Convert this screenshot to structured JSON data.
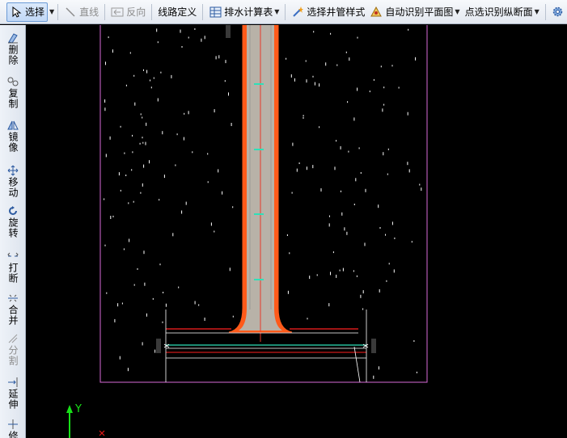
{
  "toolbar": {
    "select_label": "选择",
    "line_label": "直线",
    "reverse_label": "反向",
    "route_define_label": "线路定义",
    "drain_calc_label": "排水计算表",
    "select_well_style_label": "选择井管样式",
    "auto_recognize_label": "自动识别平面图",
    "point_recognize_label": "点选识别纵断面",
    "cut_off_label": "选"
  },
  "sidebar": {
    "items": [
      {
        "label": "删除",
        "icon": "eraser-icon",
        "enabled": true
      },
      {
        "label": "复制",
        "icon": "copy-icon",
        "enabled": true
      },
      {
        "label": "镜像",
        "icon": "mirror-icon",
        "enabled": true
      },
      {
        "label": "移动",
        "icon": "move-icon",
        "enabled": true
      },
      {
        "label": "旋转",
        "icon": "rotate-icon",
        "enabled": true
      },
      {
        "label": "打断",
        "icon": "break-icon",
        "enabled": true
      },
      {
        "label": "合并",
        "icon": "merge-icon",
        "enabled": true
      },
      {
        "label": "分割",
        "icon": "split-icon",
        "enabled": false
      },
      {
        "label": "延伸",
        "icon": "extend-icon",
        "enabled": true
      },
      {
        "label": "修",
        "icon": "trim-icon",
        "enabled": true
      }
    ]
  },
  "canvas": {
    "ucs_y_label": "Y",
    "background": "#000000",
    "colors": {
      "frame_magenta": "#d96ad9",
      "pipe_fill": "#b8b2a8",
      "pipe_outline_orange": "#ff5a1a",
      "base_red": "#ff2020",
      "cyan_line": "#2ee0b8",
      "axis_green": "#18e018",
      "axis_red": "#e01818"
    }
  }
}
